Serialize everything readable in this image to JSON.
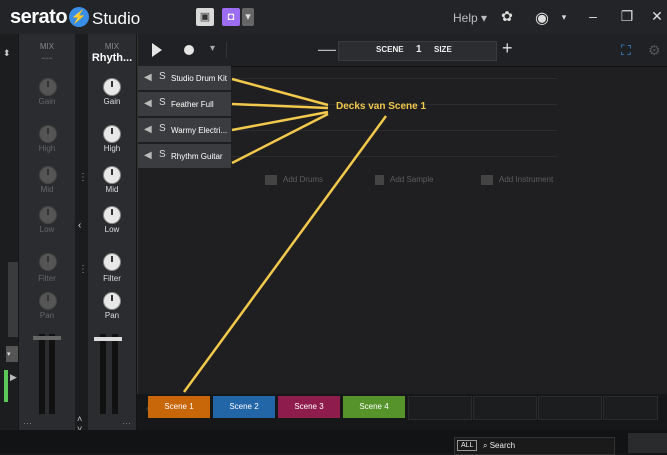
{
  "app": {
    "logo": "serato",
    "product": "Studio",
    "help_label": "Help"
  },
  "colors": {
    "accent_blue": "#3a8ee6",
    "annotation_yellow": "#f2c94c"
  },
  "mixer": {
    "left_column": {
      "label": "MIX",
      "sub": "---",
      "knobs": [
        "Gain",
        "High",
        "Mid",
        "Low",
        "Filter",
        "Pan"
      ]
    },
    "right_column": {
      "label": "MIX",
      "name": "Rhyth...",
      "knobs": [
        "Gain",
        "High",
        "Mid",
        "Low",
        "Filter",
        "Pan"
      ]
    }
  },
  "toolbar": {
    "scene_label": "SCENE",
    "scene_number": "1",
    "size_label": "SIZE"
  },
  "decks": [
    {
      "name": "Studio Drum Kit"
    },
    {
      "name": "Feather Full"
    },
    {
      "name": "Warmy Electri..."
    },
    {
      "name": "Rhythm Guitar"
    }
  ],
  "add_buttons": {
    "drums": "Add Drums",
    "sample": "Add Sample",
    "instrument": "Add Instrument"
  },
  "annotation": "Decks van Scene 1",
  "scenes": [
    {
      "label": "Scene 1",
      "color": "#c8660a"
    },
    {
      "label": "Scene 2",
      "color": "#2366a8"
    },
    {
      "label": "Scene 3",
      "color": "#8e1d4e"
    },
    {
      "label": "Scene 4",
      "color": "#56932b"
    }
  ],
  "search": {
    "scope": "ALL",
    "placeholder": "Search"
  },
  "icons": [
    "play-icon",
    "record-icon",
    "speaker-icon",
    "solo-icon",
    "fullscreen-icon",
    "settings-icon",
    "user-icon",
    "minimize-icon",
    "maximize-icon",
    "close-icon"
  ]
}
